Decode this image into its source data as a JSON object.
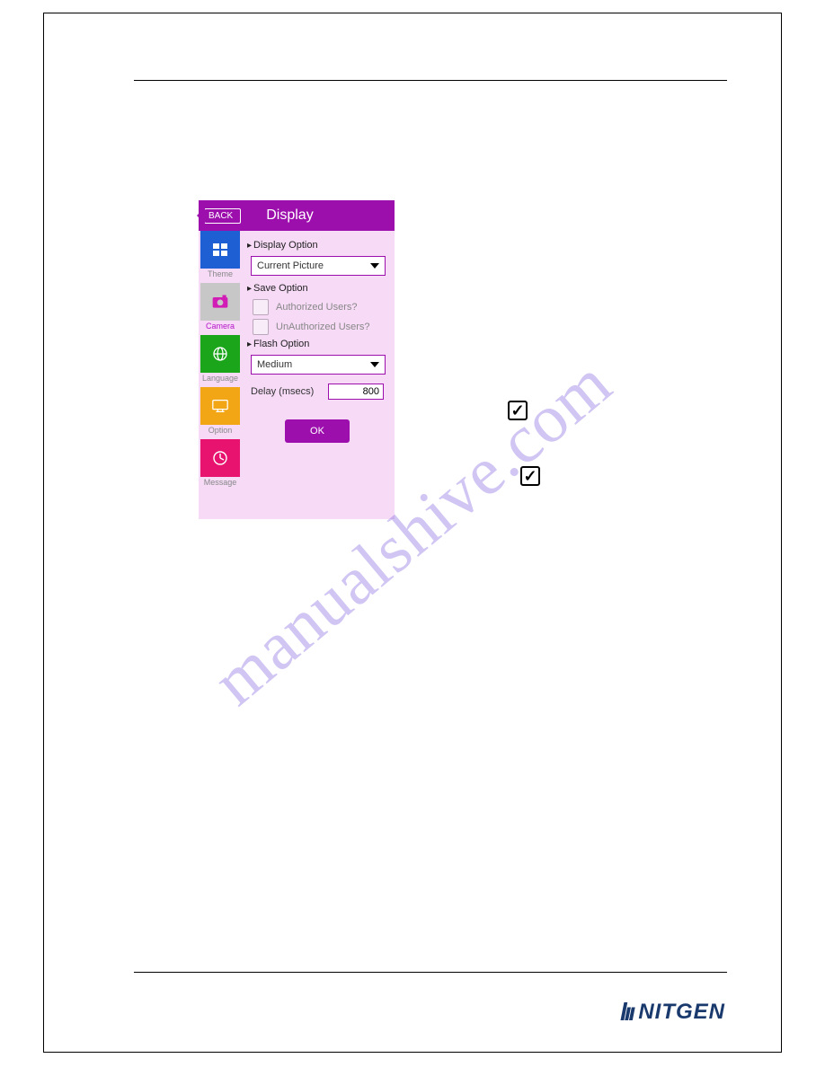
{
  "logo": {
    "text": "NITGEN"
  },
  "watermark": "manualshive.com",
  "device": {
    "back_label": "BACK",
    "title": "Display",
    "sidebar": [
      {
        "key": "theme",
        "label": "Theme"
      },
      {
        "key": "camera",
        "label": "Camera"
      },
      {
        "key": "language",
        "label": "Language"
      },
      {
        "key": "option",
        "label": "Option"
      },
      {
        "key": "message",
        "label": "Message"
      }
    ],
    "display_option": {
      "heading": "Display Option",
      "selected": "Current Picture"
    },
    "save_option": {
      "heading": "Save Option",
      "authorized_label": "Authorized Users?",
      "unauthorized_label": "UnAuthorized Users?"
    },
    "flash_option": {
      "heading": "Flash Option",
      "selected": "Medium"
    },
    "delay": {
      "label": "Delay (msecs)",
      "value": "800"
    },
    "ok_label": "OK"
  }
}
